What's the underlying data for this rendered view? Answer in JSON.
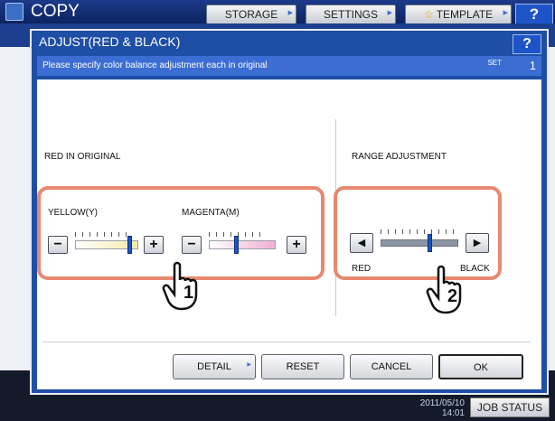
{
  "app": {
    "title": "COPY",
    "tabs": [
      {
        "label": "STORAGE"
      },
      {
        "label": "SETTINGS"
      },
      {
        "label": "TEMPLATE"
      }
    ],
    "help_label": "?",
    "datetime_date": "2011/05/10",
    "datetime_time": "14:01",
    "job_status_label": "JOB STATUS"
  },
  "dialog": {
    "title": "ADJUST(RED & BLACK)",
    "help_label": "?",
    "message": "Please specify color balance adjustment each in original",
    "set_label": "SET",
    "set_count": "1",
    "red_section": {
      "label": "RED IN ORIGINAL",
      "yellow": {
        "label": "YELLOW(Y)",
        "minus": "−",
        "plus": "+",
        "level": 0.9
      },
      "magenta": {
        "label": "MAGENTA(M)",
        "minus": "−",
        "plus": "+",
        "level": 0.4
      }
    },
    "range_section": {
      "label": "RANGE ADJUSTMENT",
      "left_end": "RED",
      "right_end": "BLACK",
      "left_arrow": "◀",
      "right_arrow": "▶",
      "level": 0.65
    },
    "callouts": [
      "1",
      "2"
    ],
    "buttons": {
      "detail": "DETAIL",
      "reset": "RESET",
      "cancel": "CANCEL",
      "ok": "OK"
    }
  },
  "colors": {
    "header_blue": "#1c3a8a",
    "highlight": "#e8896f",
    "thumb": "#1e54c8"
  }
}
